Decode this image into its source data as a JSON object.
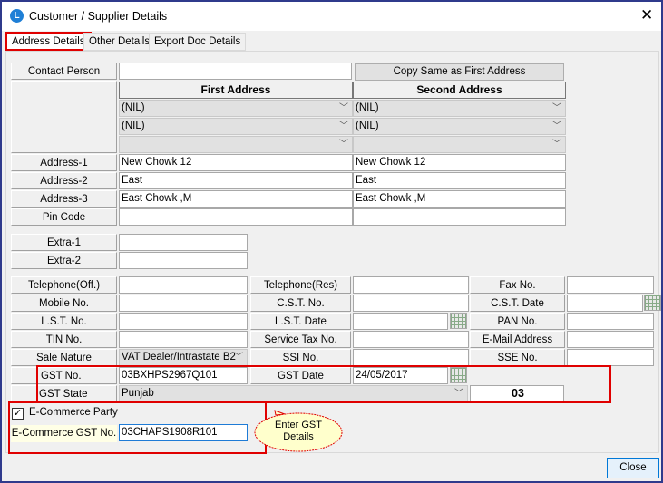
{
  "window": {
    "title": "Customer / Supplier Details",
    "logo": "L"
  },
  "tabs": [
    {
      "label": "Address Details",
      "active": true
    },
    {
      "label": "Other Details"
    },
    {
      "label": "Export Doc Details"
    }
  ],
  "contact": {
    "label": "Contact Person",
    "value": "",
    "copy_button": "Copy Same as First Address"
  },
  "address": {
    "first_header": "First Address",
    "second_header": "Second Address",
    "first_combos": [
      "(NIL)",
      "(NIL)",
      ""
    ],
    "second_combos": [
      "(NIL)",
      "(NIL)",
      ""
    ],
    "rows": [
      {
        "label": "Address-1",
        "first": "New Chowk 12",
        "second": "New Chowk 12"
      },
      {
        "label": "Address-2",
        "first": "East",
        "second": "East"
      },
      {
        "label": "Address-3",
        "first": "East Chowk ,M",
        "second": "East Chowk ,M"
      },
      {
        "label": "Pin Code",
        "first": "",
        "second": ""
      }
    ]
  },
  "extra": [
    {
      "label": "Extra-1",
      "value": ""
    },
    {
      "label": "Extra-2",
      "value": ""
    }
  ],
  "grid": [
    [
      {
        "label": "Telephone(Off.)",
        "value": ""
      },
      {
        "label": "Telephone(Res)",
        "value": ""
      },
      {
        "label": "Fax No.",
        "value": ""
      }
    ],
    [
      {
        "label": "Mobile No.",
        "value": ""
      },
      {
        "label": "C.S.T. No.",
        "value": ""
      },
      {
        "label": "C.S.T. Date",
        "value": ""
      }
    ],
    [
      {
        "label": "L.S.T. No.",
        "value": ""
      },
      {
        "label": "L.S.T. Date",
        "value": ""
      },
      {
        "label": "PAN No.",
        "value": ""
      }
    ],
    [
      {
        "label": "TIN No.",
        "value": ""
      },
      {
        "label": "Service Tax No.",
        "value": ""
      },
      {
        "label": "E-Mail Address",
        "value": ""
      }
    ],
    [
      {
        "label": "Sale Nature",
        "value": "VAT Dealer/Intrastate B2"
      },
      {
        "label": "SSI No.",
        "value": ""
      },
      {
        "label": "SSE No.",
        "value": ""
      }
    ]
  ],
  "gst": {
    "no_label": "GST No.",
    "no_value": "03BXHPS2967Q101",
    "date_label": "GST Date",
    "date_value": "24/05/2017",
    "state_label": "GST State",
    "state_value": "Punjab",
    "state_code": "03"
  },
  "ecommerce": {
    "checkbox_label": "E-Commerce Party",
    "checked": true,
    "gst_label": "E-Commerce GST No.",
    "gst_value": "03CHAPS1908R101"
  },
  "callout": {
    "text": "Enter GST Details"
  },
  "close_button": "Close",
  "colors": {
    "highlight": "#e00000",
    "border": "#2f3a8c",
    "callout_fill": "#ffffcc"
  }
}
